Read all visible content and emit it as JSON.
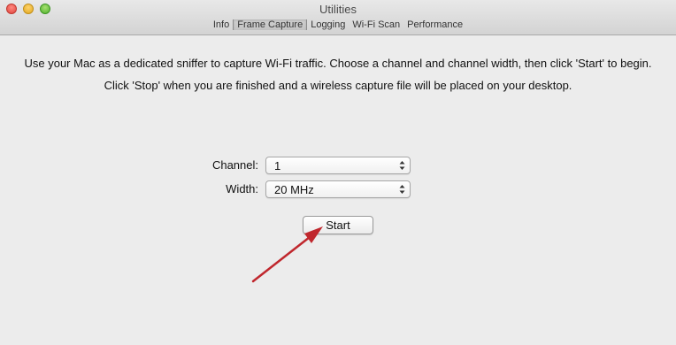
{
  "window": {
    "title": "Utilities"
  },
  "tabs": [
    {
      "label": "Info",
      "active": false
    },
    {
      "label": "Frame Capture",
      "active": true
    },
    {
      "label": "Logging",
      "active": false
    },
    {
      "label": "Wi-Fi Scan",
      "active": false
    },
    {
      "label": "Performance",
      "active": false
    }
  ],
  "instructions": {
    "line1": "Use your Mac as a dedicated sniffer to capture Wi-Fi traffic.  Choose a channel and channel width, then click 'Start' to begin.",
    "line2": "Click 'Stop' when you are finished and a wireless capture file will be placed on your desktop."
  },
  "form": {
    "channel_label": "Channel:",
    "channel_value": "1",
    "width_label": "Width:",
    "width_value": "20 MHz"
  },
  "start_button": {
    "label": "Start"
  },
  "colors": {
    "annotation_arrow": "#c0272d",
    "window_background": "#ececec"
  },
  "icons": {
    "annotation": "red-arrow-icon",
    "select_arrows": "up-down-chevron-icon"
  }
}
